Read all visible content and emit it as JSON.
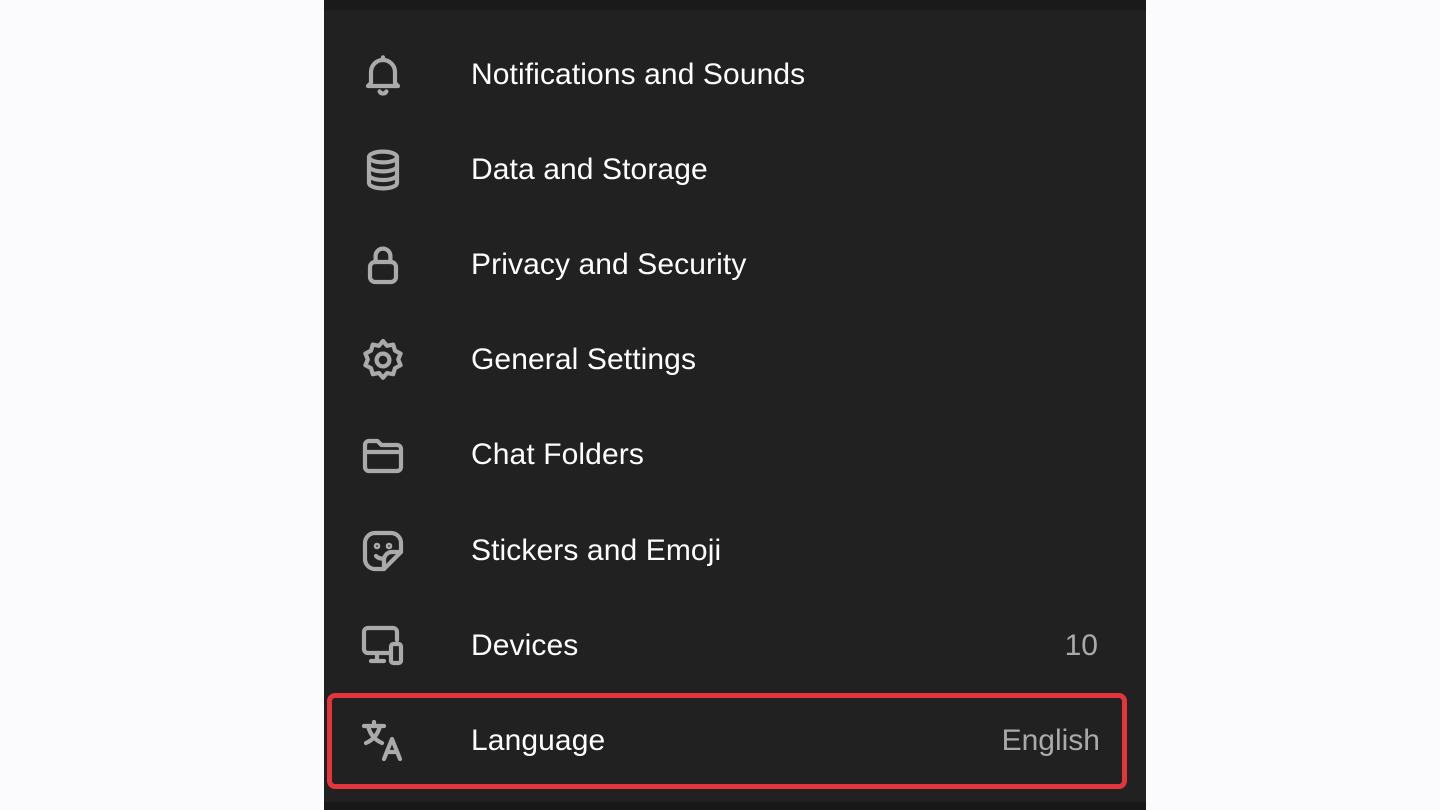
{
  "settings": {
    "items": [
      {
        "label": "Notifications and Sounds",
        "icon": "bell-icon",
        "value": ""
      },
      {
        "label": "Data and Storage",
        "icon": "database-icon",
        "value": ""
      },
      {
        "label": "Privacy and Security",
        "icon": "lock-icon",
        "value": ""
      },
      {
        "label": "General Settings",
        "icon": "gear-icon",
        "value": ""
      },
      {
        "label": "Chat Folders",
        "icon": "folder-icon",
        "value": ""
      },
      {
        "label": "Stickers and Emoji",
        "icon": "sticker-icon",
        "value": ""
      },
      {
        "label": "Devices",
        "icon": "devices-icon",
        "value": "10"
      },
      {
        "label": "Language",
        "icon": "translate-icon",
        "value": "English"
      }
    ]
  },
  "colors": {
    "panel_background": "#212121",
    "page_background": "#fbfbfd",
    "text_primary": "#ffffff",
    "text_secondary": "#aaaaaa",
    "highlight": "#e2363c"
  }
}
